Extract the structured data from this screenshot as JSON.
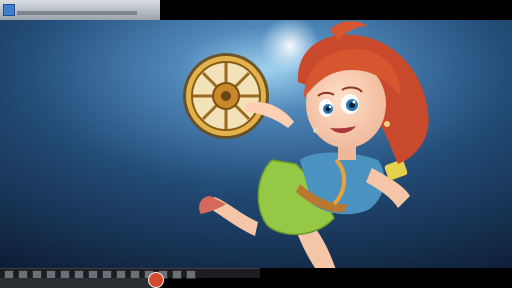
{
  "window": {
    "title": "",
    "subtitle": ""
  },
  "status": {
    "text": ""
  },
  "taskbar": {
    "buttons": [
      "btn-1",
      "btn-2",
      "btn-3",
      "btn-4",
      "btn-5",
      "btn-6",
      "btn-7",
      "btn-8",
      "btn-9",
      "btn-10",
      "btn-11",
      "btn-12",
      "btn-13",
      "btn-14"
    ]
  },
  "colors": {
    "background": "#1d3d63",
    "hair": "#c6472c",
    "skirt": "#8ec64a",
    "shirt": "#3f8fb8",
    "clock": "#d8a536",
    "glow": "#e8f4ff"
  }
}
